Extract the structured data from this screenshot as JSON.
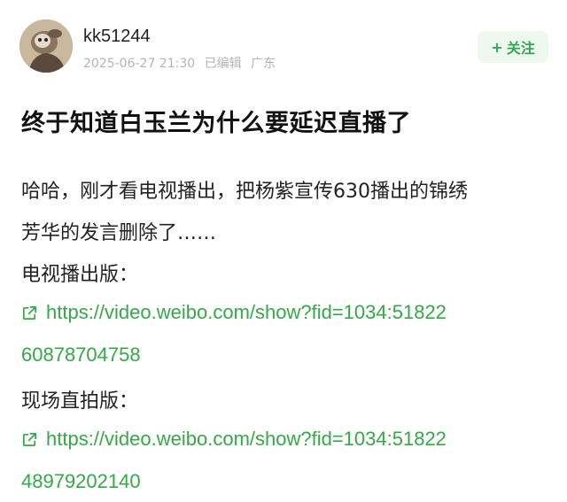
{
  "post": {
    "author": "kk51244",
    "timestamp": "2025-06-27 21:30",
    "edited": "已编辑",
    "location": "广东",
    "follow_label": "关注",
    "follow_plus": "+",
    "title": "终于知道白玉兰为什么要延迟直播了",
    "body_line1": "哈哈，刚才看电视播出，把杨紫宣传630播出的锦绣",
    "body_line2": "芳华的发言删除了……",
    "section1_label": "电视播出版：",
    "link1_part1": "https://video.weibo.com/show?fid=1034:51822",
    "link1_part2": "60878704758",
    "section2_label": "现场直拍版：",
    "link2_part1": "https://video.weibo.com/show?fid=1034:51822",
    "link2_part2": "48979202140"
  },
  "colors": {
    "link": "#35a945",
    "follow_bg": "#eef8ee",
    "meta": "#b5b5b5"
  },
  "icons": [
    "avatar-image",
    "external-link-icon"
  ]
}
